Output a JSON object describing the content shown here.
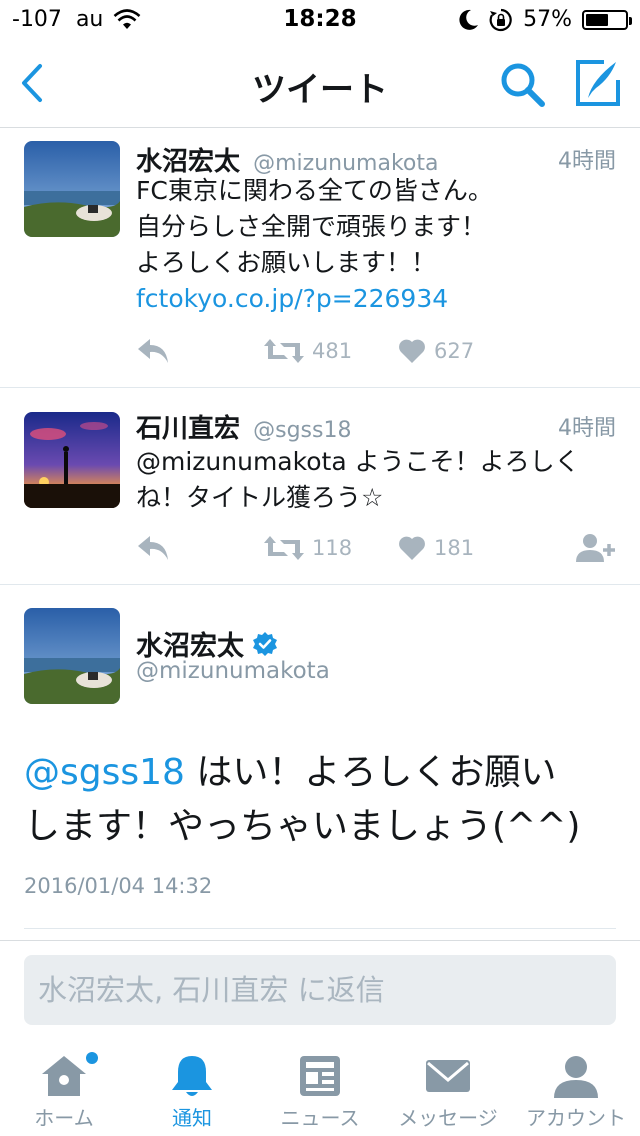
{
  "status_bar": {
    "signal": "-107",
    "carrier": "au",
    "time": "18:28",
    "battery_percent": "57%",
    "battery_level": 0.57,
    "icons": [
      "wifi-icon",
      "moon-icon",
      "rotation-lock-icon",
      "battery-icon"
    ]
  },
  "nav": {
    "title": "ツイート",
    "icons": [
      "back-chevron-icon",
      "search-icon",
      "compose-icon"
    ],
    "accent_color": "#1b95e0"
  },
  "tweets": [
    {
      "name": "水沼宏太",
      "handle": "@mizunumakota",
      "time": "4時間",
      "text_lines": [
        "FC東京に関わる全ての皆さん。",
        "自分らしさ全開で頑張ります！",
        "よろしくお願いします！！"
      ],
      "link": "fctokyo.co.jp/?p=226934",
      "retweets": "481",
      "likes": "627"
    },
    {
      "name": "石川直宏",
      "handle": "@sgss18",
      "time": "4時間",
      "text_lines": [
        "@mizunumakota ようこそ！よろしく",
        "ね！タイトル獲ろう☆"
      ],
      "retweets": "118",
      "likes": "181"
    }
  ],
  "focused_tweet": {
    "name": "水沼宏太",
    "handle": "@mizunumakota",
    "mention": "@sgss18",
    "text_line1_rest": " はい！よろしくお願い",
    "text_line2": "します！やっちゃいましょう(^^)",
    "date": "2016/01/04 14:32",
    "verified": true
  },
  "reply": {
    "placeholder": "水沼宏太, 石川直宏 に返信"
  },
  "tab_bar": {
    "tabs": [
      {
        "label": "ホーム",
        "icon": "home-icon",
        "badge": true
      },
      {
        "label": "通知",
        "icon": "bell-icon",
        "active": true
      },
      {
        "label": "ニュース",
        "icon": "news-icon"
      },
      {
        "label": "メッセージ",
        "icon": "envelope-icon"
      },
      {
        "label": "アカウント",
        "icon": "person-icon"
      }
    ]
  }
}
